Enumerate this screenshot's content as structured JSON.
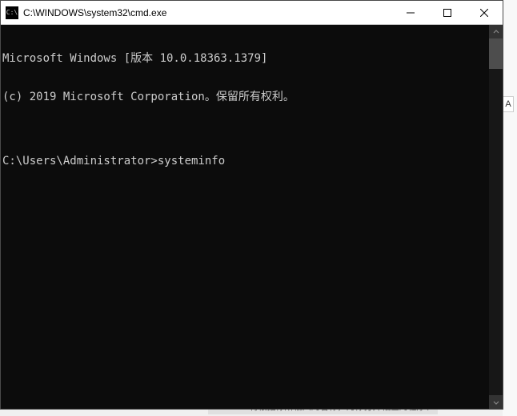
{
  "window": {
    "title": "C:\\WINDOWS\\system32\\cmd.exe"
  },
  "console": {
    "line1": "Microsoft Windows [版本 10.0.18363.1379]",
    "line2": "(c) 2019 Microsoft Corporation。保留所有权利。",
    "blank": "",
    "prompt_line": "C:\\Users\\Administrator>systeminfo"
  },
  "background": {
    "tab_letter": "A",
    "bottom_text": "Windows 将根据你所输入的名称，为你打开相应的程序、"
  }
}
